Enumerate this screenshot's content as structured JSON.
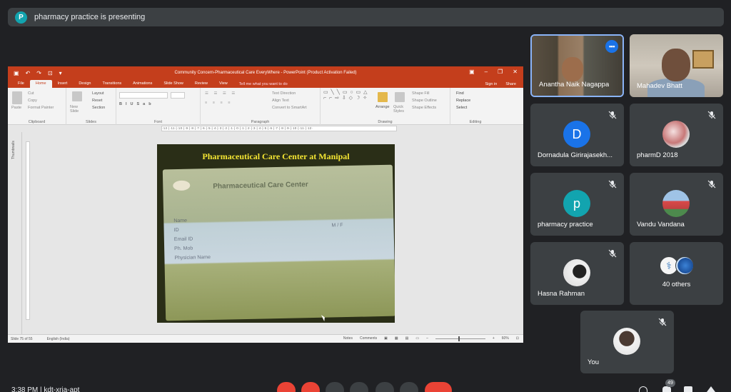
{
  "banner": {
    "avatar_letter": "P",
    "text": "pharmacy practice is presenting"
  },
  "powerpoint": {
    "title": "Community Concern-Pharmaceutical Care EveryWhere - PowerPoint (Product Activation Failed)",
    "tabs": [
      "File",
      "Home",
      "Insert",
      "Design",
      "Transitions",
      "Animations",
      "Slide Show",
      "Review",
      "View"
    ],
    "tell_me": "Tell me what you want to do",
    "sign_in": "Sign in",
    "share": "Share",
    "groups": {
      "clipboard": "Clipboard",
      "slides": "Slides",
      "font": "Font",
      "paragraph": "Paragraph",
      "drawing": "Drawing",
      "editing": "Editing"
    },
    "ribbon_items": {
      "paste": "Paste",
      "cut": "Cut",
      "copy": "Copy",
      "format_painter": "Format Painter",
      "new_slide": "New Slide",
      "layout": "Layout",
      "reset": "Reset",
      "section": "Section",
      "text_direction": "Text Direction",
      "align_text": "Align Text",
      "convert_smartart": "Convert to SmartArt",
      "arrange": "Arrange",
      "quick_styles": "Quick Styles",
      "shape_fill": "Shape Fill",
      "shape_outline": "Shape Outline",
      "shape_effects": "Shape Effects",
      "find": "Find",
      "replace": "Replace",
      "select": "Select"
    },
    "ruler_text": "·12·|·11·|·10·|·9·|·8·|·7·|·6·|·5·|·4·|·3·|·2·|·1·|·0·|·1·|·2·|·3·|·4·|·5·|·6·|·7·|·8·|·9·|·10·|·11·|·12·",
    "thumbnails_label": "Thumbnails",
    "slide": {
      "title": "Pharmaceutical Care Center at Manipal",
      "card_name": "Pharmaceutical Care Center",
      "card_fields": [
        "Name",
        "ID",
        "Email ID",
        "Ph. Mob",
        "Physician Name"
      ],
      "card_extra": "M / F"
    },
    "status": {
      "slide_count": "Slide 75 of 55",
      "language": "English (India)",
      "notes": "Notes",
      "comments": "Comments",
      "zoom": "60%"
    }
  },
  "participants": [
    {
      "name": "Anantha Naik Nagappa",
      "type": "video"
    },
    {
      "name": "Mahadev Bhatt",
      "type": "video"
    },
    {
      "name": "Dornadula Girirajasekh...",
      "type": "letter",
      "letter": "D",
      "color": "#1a73e8"
    },
    {
      "name": "pharmD 2018",
      "type": "photo"
    },
    {
      "name": "pharmacy practice",
      "type": "letter",
      "letter": "p",
      "color": "#12a4af"
    },
    {
      "name": "Vandu Vandana",
      "type": "photo"
    },
    {
      "name": "Hasna Rahman",
      "type": "photo"
    },
    {
      "name": "40 others",
      "type": "group"
    },
    {
      "name": "You",
      "type": "photo"
    }
  ],
  "bottom": {
    "time": "3:38 PM  |  kdt-xrja-apt",
    "badge": "49"
  }
}
